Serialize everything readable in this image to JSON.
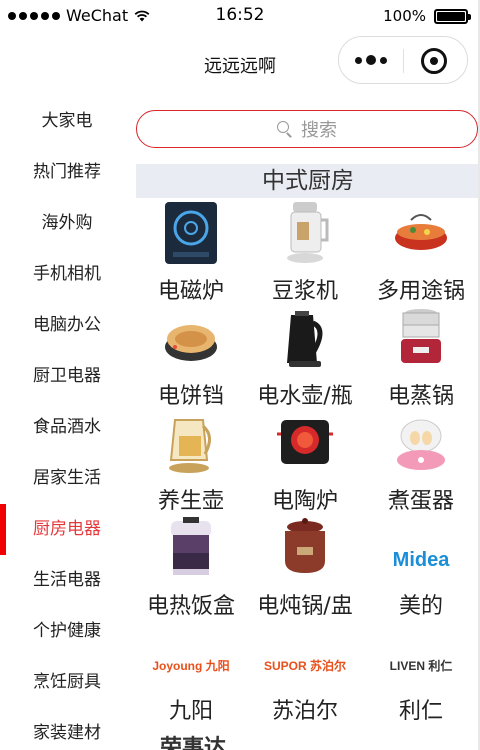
{
  "status_bar": {
    "carrier": "WeChat",
    "time": "16:52",
    "battery": "100%",
    "battery_level": 1.0
  },
  "nav": {
    "title": "远远远啊"
  },
  "search": {
    "placeholder": "搜索",
    "accent": "#d8262a"
  },
  "sidebar": {
    "active_color": "#e4393c",
    "items": [
      {
        "label": "大家电"
      },
      {
        "label": "热门推荐"
      },
      {
        "label": "海外购"
      },
      {
        "label": "手机相机"
      },
      {
        "label": "电脑办公"
      },
      {
        "label": "厨卫电器"
      },
      {
        "label": "食品酒水"
      },
      {
        "label": "居家生活"
      },
      {
        "label": "厨房电器",
        "active": true
      },
      {
        "label": "生活电器"
      },
      {
        "label": "个护健康"
      },
      {
        "label": "烹饪厨具"
      },
      {
        "label": "家装建材"
      }
    ]
  },
  "section": {
    "title": "中式厨房"
  },
  "products": [
    {
      "label": "电磁炉",
      "icon": "induction-cooker-icon"
    },
    {
      "label": "豆浆机",
      "icon": "soymilk-maker-icon"
    },
    {
      "label": "多用途锅",
      "icon": "multi-pot-icon"
    },
    {
      "label": "电饼铛",
      "icon": "griddle-icon"
    },
    {
      "label": "电水壶/瓶",
      "icon": "kettle-icon"
    },
    {
      "label": "电蒸锅",
      "icon": "steamer-icon"
    },
    {
      "label": "养生壶",
      "icon": "health-pot-icon"
    },
    {
      "label": "电陶炉",
      "icon": "ceramic-cooker-icon"
    },
    {
      "label": "煮蛋器",
      "icon": "egg-cooker-icon"
    },
    {
      "label": "电热饭盒",
      "icon": "lunch-box-icon"
    },
    {
      "label": "电炖锅/盅",
      "icon": "slow-cooker-icon"
    },
    {
      "label": "美的",
      "icon": "midea-logo",
      "logo_text": "Midea",
      "logo_color": "#1a8fd8"
    },
    {
      "label": "九阳",
      "icon": "joyoung-logo",
      "logo_text": "Joyoung 九阳",
      "logo_color": "#e8501c"
    },
    {
      "label": "苏泊尔",
      "icon": "supor-logo",
      "logo_text": "SUPOR 苏泊尔",
      "logo_color": "#e8501c"
    },
    {
      "label": "利仁",
      "icon": "liven-logo",
      "logo_text": "LIVEN 利仁",
      "logo_color": "#333333"
    }
  ],
  "partial_next": "荣事达"
}
